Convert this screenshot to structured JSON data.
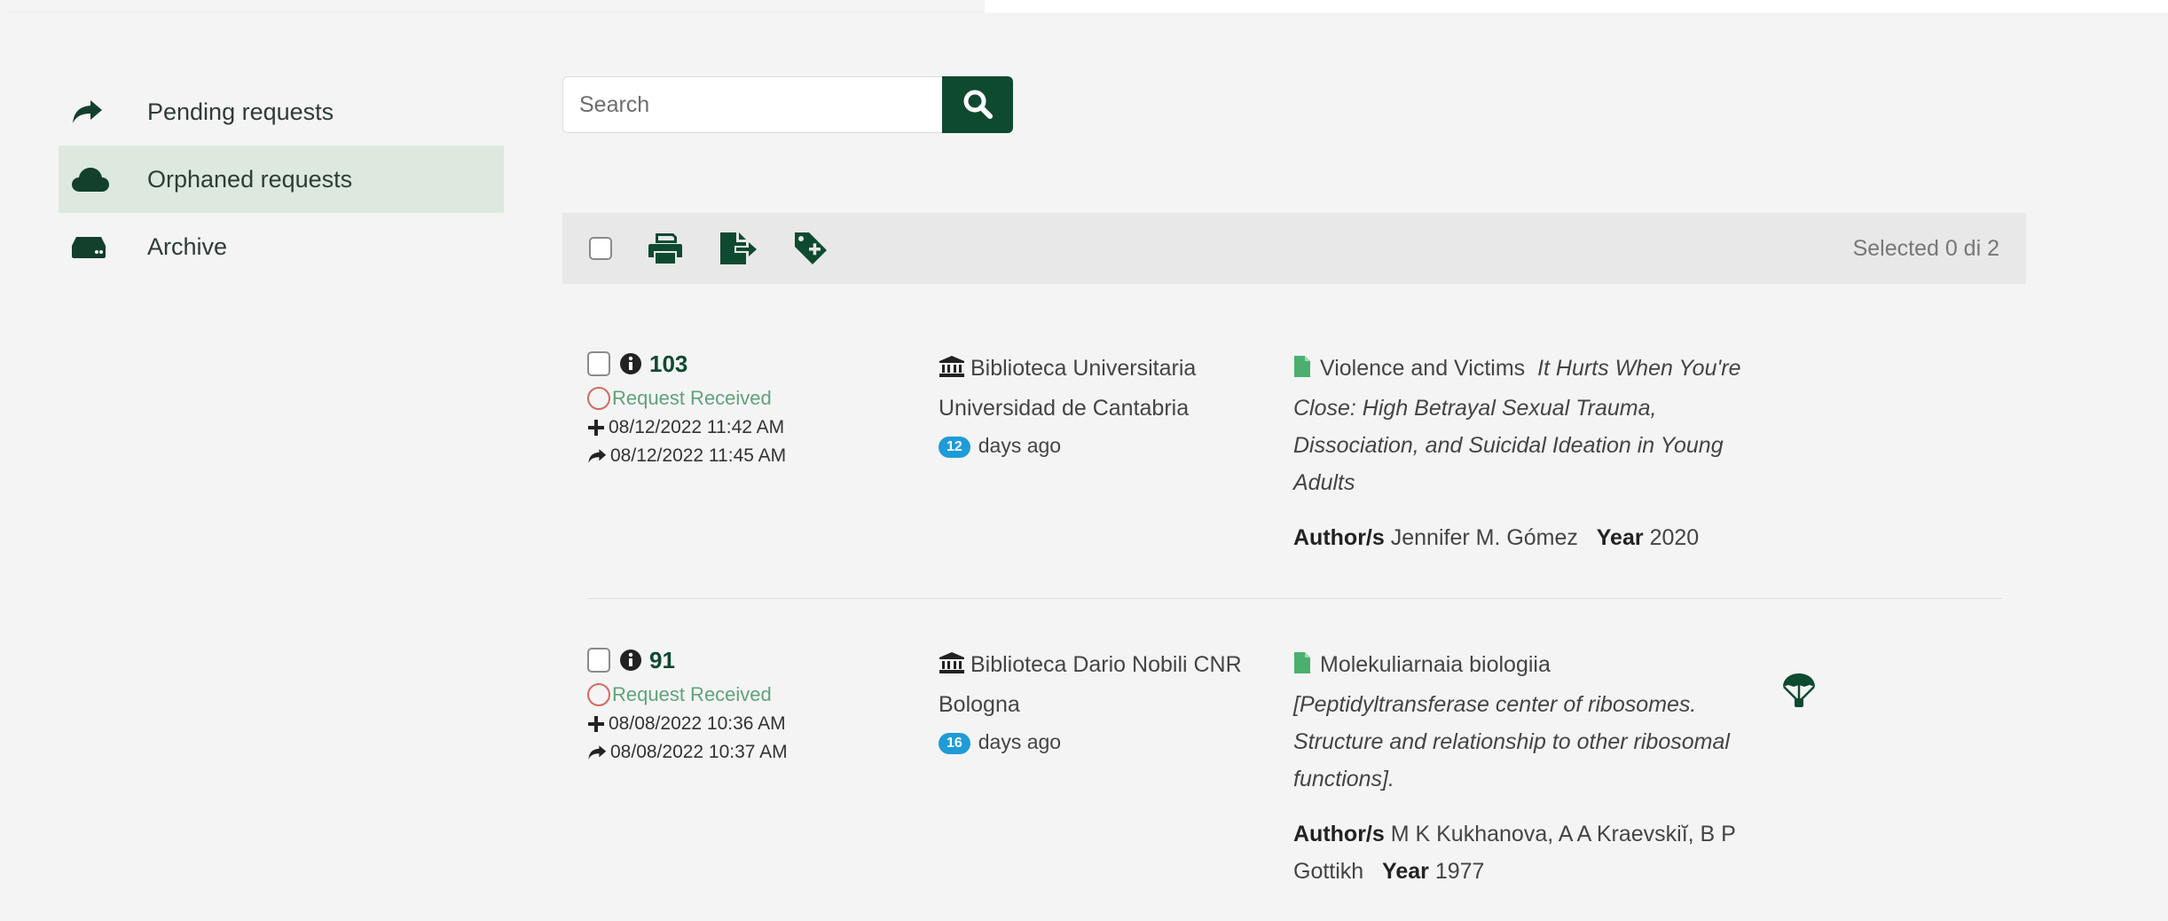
{
  "sidebar": {
    "items": [
      {
        "label": "Pending requests",
        "icon": "share-arrow-icon",
        "active": false
      },
      {
        "label": "Orphaned requests",
        "icon": "cloud-icon",
        "active": true
      },
      {
        "label": "Archive",
        "icon": "hard-drive-icon",
        "active": false
      }
    ]
  },
  "search": {
    "placeholder": "Search",
    "value": ""
  },
  "toolbar": {
    "selected_text": "Selected 0 di 2"
  },
  "records": [
    {
      "id": "103",
      "status": "Request Received",
      "created": "08/12/2022 11:42 AM",
      "forwarded": "08/12/2022 11:45 AM",
      "library_line1": "Biblioteca Universitaria",
      "library_line2": "Universidad de Cantabria",
      "days_count": "12",
      "days_label": "days ago",
      "journal": "Violence and Victims",
      "article_title": "It Hurts When You're Close: High Betrayal Sexual Trauma, Dissociation, and Suicidal Ideation in Young Adults",
      "author_label": "Author/s",
      "authors": "Jennifer M. Gómez",
      "year_label": "Year",
      "year": "2020"
    },
    {
      "id": "91",
      "status": "Request Received",
      "created": "08/08/2022 10:36 AM",
      "forwarded": "08/08/2022 10:37 AM",
      "library_line1": "Biblioteca Dario Nobili CNR",
      "library_line2": "Bologna",
      "days_count": "16",
      "days_label": "days ago",
      "journal": "Molekuliarnaia biologiia",
      "article_title": "[Peptidyltransferase center of ribosomes. Structure and relationship to other ribosomal functions].",
      "author_label": "Author/s",
      "authors": "M K Kukhanova, A A Kraevskiĭ, B P Gottikh",
      "year_label": "Year",
      "year": "1977"
    }
  ],
  "colors": {
    "brand_green": "#0e4a30",
    "active_bg": "#dde9df",
    "status_green": "#5fa37a",
    "status_circle": "#d36a5e",
    "badge_blue": "#1f9bd7",
    "doc_icon_green": "#4caf6e"
  }
}
